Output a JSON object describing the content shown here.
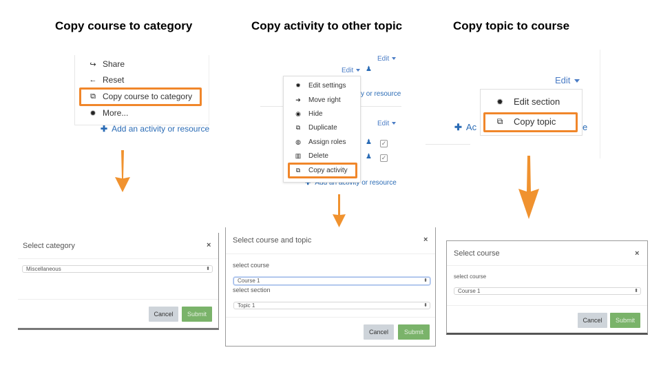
{
  "headings": [
    "Copy course to category",
    "Copy activity to other topic",
    "Copy topic to course"
  ],
  "panel1": {
    "menu_items": [
      {
        "icon": "share-icon",
        "glyph": "↪",
        "label": "Share"
      },
      {
        "icon": "arrow-left-icon",
        "glyph": "←",
        "label": "Reset"
      },
      {
        "icon": "copy-icon",
        "glyph": "⧉",
        "label": "Copy course to category",
        "highlighted": true
      },
      {
        "icon": "gear-icon",
        "glyph": "✹",
        "label": "More..."
      }
    ],
    "add_link": "Add an activity or resource"
  },
  "panel2": {
    "edit_labels": [
      "Edit",
      "Edit",
      "Edit"
    ],
    "partial_link": "y or resource",
    "menu_items": [
      {
        "icon": "gear-icon",
        "glyph": "✹",
        "label": "Edit settings"
      },
      {
        "icon": "arrow-right-icon",
        "glyph": "➔",
        "label": "Move right"
      },
      {
        "icon": "eye-icon",
        "glyph": "◉",
        "label": "Hide"
      },
      {
        "icon": "duplicate-icon",
        "glyph": "⧉",
        "label": "Duplicate"
      },
      {
        "icon": "user-circle-icon",
        "glyph": "◍",
        "label": "Assign roles"
      },
      {
        "icon": "trash-icon",
        "glyph": "▥",
        "label": "Delete"
      },
      {
        "icon": "copy-icon",
        "glyph": "⧉",
        "label": "Copy activity",
        "highlighted": true
      }
    ],
    "add_link": "Add an activity or resource"
  },
  "panel3": {
    "edit_label": "Edit",
    "menu_items": [
      {
        "icon": "gear-icon",
        "glyph": "✹",
        "label": "Edit section"
      },
      {
        "icon": "copy-icon",
        "glyph": "⧉",
        "label": "Copy topic",
        "highlighted": true
      }
    ],
    "partial_link_left": "Ac",
    "partial_link_right": "e"
  },
  "dialogs": {
    "category": {
      "title": "Select category",
      "close": "×",
      "select_value": "Miscellaneous",
      "cancel": "Cancel",
      "submit": "Submit"
    },
    "course_topic": {
      "title": "Select course and topic",
      "close": "×",
      "course_label": "select course",
      "course_value": "Course 1",
      "section_label": "select section",
      "section_value": "Topic 1",
      "cancel": "Cancel",
      "submit": "Submit"
    },
    "course": {
      "title": "Select course",
      "close": "×",
      "course_label": "select course",
      "course_value": "Course 1",
      "cancel": "Cancel",
      "submit": "Submit"
    }
  },
  "colors": {
    "highlight": "#f0862a",
    "link": "#2a6bb5",
    "submit": "#7ab36a",
    "cancel": "#ced4da"
  },
  "glyphs": {
    "plus": "✚",
    "person": "♟",
    "check": "✓",
    "spin": "⬍"
  }
}
